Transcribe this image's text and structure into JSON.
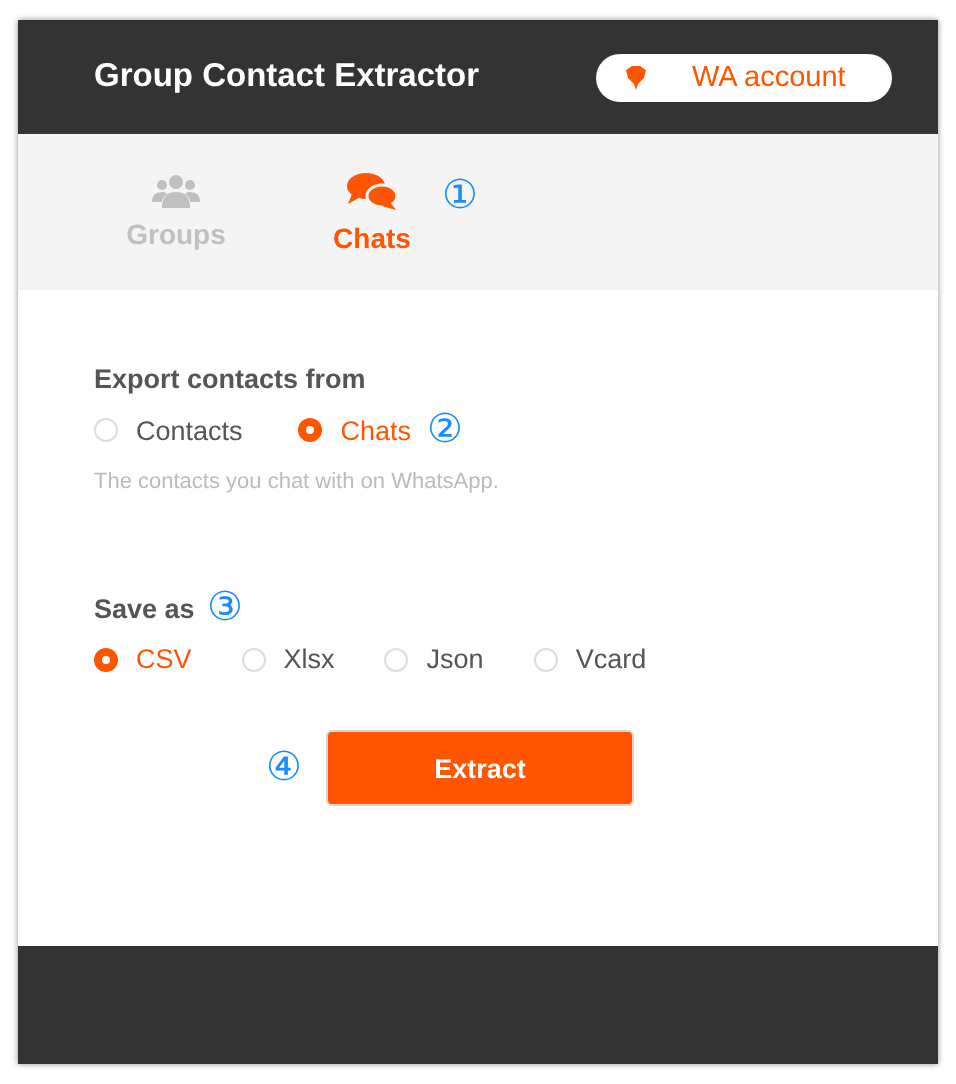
{
  "window": {
    "title": "Group Contact Extractor"
  },
  "account_button": {
    "label": "WA account"
  },
  "tabs": [
    {
      "label": "Groups",
      "kind": "groups",
      "selected": false
    },
    {
      "label": "Chats",
      "kind": "chats",
      "selected": true,
      "callout": "①"
    }
  ],
  "export_from": {
    "label": "Export contacts from",
    "callout": "②",
    "options": [
      {
        "label": "Contacts",
        "selected": false
      },
      {
        "label": "Chats",
        "selected": true
      }
    ],
    "hint": "The contacts you chat with on WhatsApp."
  },
  "save_as": {
    "label": "Save as",
    "callout": "③",
    "options": [
      {
        "label": "CSV",
        "selected": true
      },
      {
        "label": "Xlsx",
        "selected": false
      },
      {
        "label": "Json",
        "selected": false
      },
      {
        "label": "Vcard",
        "selected": false
      }
    ]
  },
  "extract_button": {
    "label": "Extract",
    "callout": "④"
  }
}
